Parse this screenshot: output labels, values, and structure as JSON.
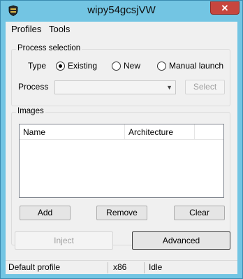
{
  "window": {
    "title": "wipy54gcsjVW",
    "close_glyph": "✕",
    "icon": "shield-icon"
  },
  "menu": {
    "items": [
      {
        "label": "Profiles"
      },
      {
        "label": "Tools"
      }
    ]
  },
  "process_selection": {
    "group_title": "Process selection",
    "type_label": "Type",
    "radio_options": [
      {
        "label": "Existing",
        "checked": true
      },
      {
        "label": "New",
        "checked": false
      },
      {
        "label": "Manual launch",
        "checked": false
      }
    ],
    "process_label": "Process",
    "process_value": "",
    "select_button": "Select"
  },
  "images": {
    "group_title": "Images",
    "columns": [
      "Name",
      "Architecture"
    ],
    "rows": [],
    "add_button": "Add",
    "remove_button": "Remove",
    "clear_button": "Clear"
  },
  "actions": {
    "inject_button": "Inject",
    "advanced_button": "Advanced"
  },
  "status": {
    "profile": "Default profile",
    "arch": "x86",
    "state": "Idle"
  },
  "colors": {
    "frame": "#73c5e3",
    "close": "#c7463e",
    "client_bg": "#f0f0f0"
  }
}
